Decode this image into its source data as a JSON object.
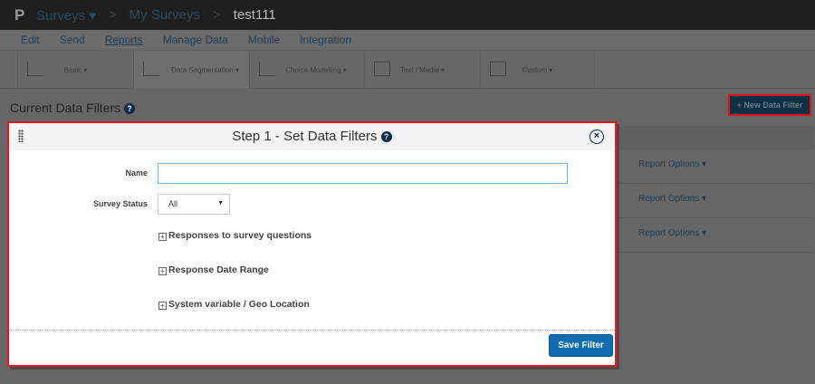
{
  "topbar": {
    "logo": "P",
    "surveys": "Surveys ▾",
    "my_surveys": "My Surveys",
    "current": "test111",
    "sep": ">"
  },
  "nav": [
    "Edit",
    "Send",
    "Reports",
    "Manage Data",
    "Mobile",
    "Integration"
  ],
  "toolbar": [
    "Basic ▾",
    "Data Segmentation ▾",
    "Choice Modelling ▾",
    "Text / Media ▾",
    "Custom ▾"
  ],
  "page": {
    "title": "Current Data Filters",
    "help": "?",
    "new_filter": "+ New Data Filter",
    "report_options": [
      "Report Options ▾",
      "Report Options ▾",
      "Report Options ▾"
    ]
  },
  "modal": {
    "title": "Step 1 - Set Data Filters",
    "help": "?",
    "close": "×",
    "name_label": "Name",
    "name_value": "",
    "status_label": "Survey Status",
    "status_value": "All",
    "status_arrow": "▼",
    "sections": [
      "Responses to survey questions",
      "Response Date Range",
      "System variable / Geo Location"
    ],
    "expand": "+",
    "save": "Save Filter"
  }
}
